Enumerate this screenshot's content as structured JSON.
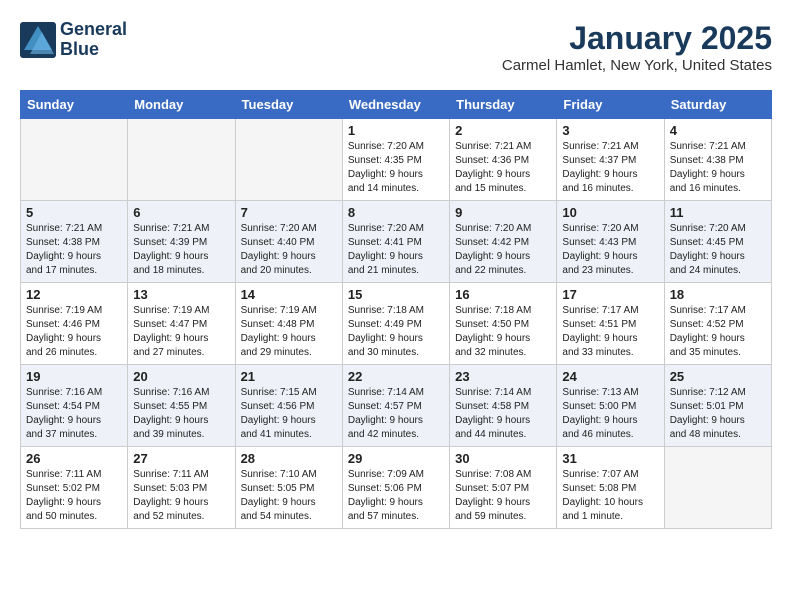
{
  "header": {
    "logo_line1": "General",
    "logo_line2": "Blue",
    "month": "January 2025",
    "location": "Carmel Hamlet, New York, United States"
  },
  "weekdays": [
    "Sunday",
    "Monday",
    "Tuesday",
    "Wednesday",
    "Thursday",
    "Friday",
    "Saturday"
  ],
  "weeks": [
    [
      {
        "day": "",
        "info": ""
      },
      {
        "day": "",
        "info": ""
      },
      {
        "day": "",
        "info": ""
      },
      {
        "day": "1",
        "info": "Sunrise: 7:20 AM\nSunset: 4:35 PM\nDaylight: 9 hours\nand 14 minutes."
      },
      {
        "day": "2",
        "info": "Sunrise: 7:21 AM\nSunset: 4:36 PM\nDaylight: 9 hours\nand 15 minutes."
      },
      {
        "day": "3",
        "info": "Sunrise: 7:21 AM\nSunset: 4:37 PM\nDaylight: 9 hours\nand 16 minutes."
      },
      {
        "day": "4",
        "info": "Sunrise: 7:21 AM\nSunset: 4:38 PM\nDaylight: 9 hours\nand 16 minutes."
      }
    ],
    [
      {
        "day": "5",
        "info": "Sunrise: 7:21 AM\nSunset: 4:38 PM\nDaylight: 9 hours\nand 17 minutes."
      },
      {
        "day": "6",
        "info": "Sunrise: 7:21 AM\nSunset: 4:39 PM\nDaylight: 9 hours\nand 18 minutes."
      },
      {
        "day": "7",
        "info": "Sunrise: 7:20 AM\nSunset: 4:40 PM\nDaylight: 9 hours\nand 20 minutes."
      },
      {
        "day": "8",
        "info": "Sunrise: 7:20 AM\nSunset: 4:41 PM\nDaylight: 9 hours\nand 21 minutes."
      },
      {
        "day": "9",
        "info": "Sunrise: 7:20 AM\nSunset: 4:42 PM\nDaylight: 9 hours\nand 22 minutes."
      },
      {
        "day": "10",
        "info": "Sunrise: 7:20 AM\nSunset: 4:43 PM\nDaylight: 9 hours\nand 23 minutes."
      },
      {
        "day": "11",
        "info": "Sunrise: 7:20 AM\nSunset: 4:45 PM\nDaylight: 9 hours\nand 24 minutes."
      }
    ],
    [
      {
        "day": "12",
        "info": "Sunrise: 7:19 AM\nSunset: 4:46 PM\nDaylight: 9 hours\nand 26 minutes."
      },
      {
        "day": "13",
        "info": "Sunrise: 7:19 AM\nSunset: 4:47 PM\nDaylight: 9 hours\nand 27 minutes."
      },
      {
        "day": "14",
        "info": "Sunrise: 7:19 AM\nSunset: 4:48 PM\nDaylight: 9 hours\nand 29 minutes."
      },
      {
        "day": "15",
        "info": "Sunrise: 7:18 AM\nSunset: 4:49 PM\nDaylight: 9 hours\nand 30 minutes."
      },
      {
        "day": "16",
        "info": "Sunrise: 7:18 AM\nSunset: 4:50 PM\nDaylight: 9 hours\nand 32 minutes."
      },
      {
        "day": "17",
        "info": "Sunrise: 7:17 AM\nSunset: 4:51 PM\nDaylight: 9 hours\nand 33 minutes."
      },
      {
        "day": "18",
        "info": "Sunrise: 7:17 AM\nSunset: 4:52 PM\nDaylight: 9 hours\nand 35 minutes."
      }
    ],
    [
      {
        "day": "19",
        "info": "Sunrise: 7:16 AM\nSunset: 4:54 PM\nDaylight: 9 hours\nand 37 minutes."
      },
      {
        "day": "20",
        "info": "Sunrise: 7:16 AM\nSunset: 4:55 PM\nDaylight: 9 hours\nand 39 minutes."
      },
      {
        "day": "21",
        "info": "Sunrise: 7:15 AM\nSunset: 4:56 PM\nDaylight: 9 hours\nand 41 minutes."
      },
      {
        "day": "22",
        "info": "Sunrise: 7:14 AM\nSunset: 4:57 PM\nDaylight: 9 hours\nand 42 minutes."
      },
      {
        "day": "23",
        "info": "Sunrise: 7:14 AM\nSunset: 4:58 PM\nDaylight: 9 hours\nand 44 minutes."
      },
      {
        "day": "24",
        "info": "Sunrise: 7:13 AM\nSunset: 5:00 PM\nDaylight: 9 hours\nand 46 minutes."
      },
      {
        "day": "25",
        "info": "Sunrise: 7:12 AM\nSunset: 5:01 PM\nDaylight: 9 hours\nand 48 minutes."
      }
    ],
    [
      {
        "day": "26",
        "info": "Sunrise: 7:11 AM\nSunset: 5:02 PM\nDaylight: 9 hours\nand 50 minutes."
      },
      {
        "day": "27",
        "info": "Sunrise: 7:11 AM\nSunset: 5:03 PM\nDaylight: 9 hours\nand 52 minutes."
      },
      {
        "day": "28",
        "info": "Sunrise: 7:10 AM\nSunset: 5:05 PM\nDaylight: 9 hours\nand 54 minutes."
      },
      {
        "day": "29",
        "info": "Sunrise: 7:09 AM\nSunset: 5:06 PM\nDaylight: 9 hours\nand 57 minutes."
      },
      {
        "day": "30",
        "info": "Sunrise: 7:08 AM\nSunset: 5:07 PM\nDaylight: 9 hours\nand 59 minutes."
      },
      {
        "day": "31",
        "info": "Sunrise: 7:07 AM\nSunset: 5:08 PM\nDaylight: 10 hours\nand 1 minute."
      },
      {
        "day": "",
        "info": ""
      }
    ]
  ]
}
